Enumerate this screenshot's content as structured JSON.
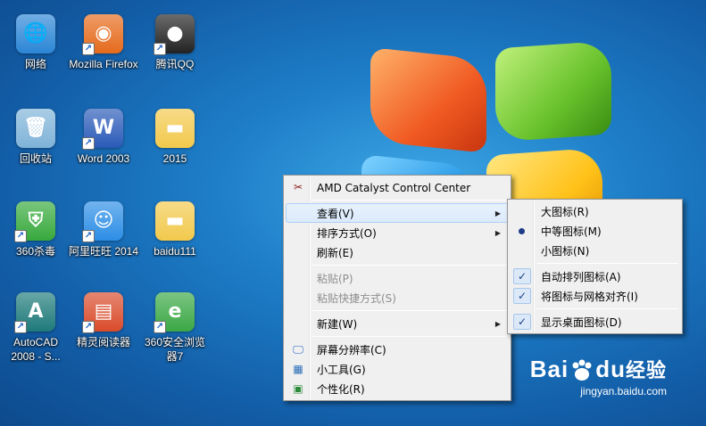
{
  "desktop": {
    "icons": [
      {
        "label": "网络",
        "color": "#2b86d6",
        "glyph": "network-icon",
        "shortcut": false
      },
      {
        "label": "Mozilla Firefox",
        "color": "#e56a1c",
        "glyph": "firefox-icon",
        "shortcut": true
      },
      {
        "label": "腾讯QQ",
        "color": "#222222",
        "glyph": "qq-penguin-icon",
        "shortcut": true
      },
      {
        "label": "回收站",
        "color": "#7fb3d8",
        "glyph": "recycle-bin-icon",
        "shortcut": false
      },
      {
        "label": "Word 2003",
        "color": "#2a5ab8",
        "glyph": "word-icon",
        "shortcut": true
      },
      {
        "label": "2015",
        "color": "#f2c94c",
        "glyph": "folder-icon",
        "shortcut": false
      },
      {
        "label": "360杀毒",
        "color": "#37a93c",
        "glyph": "shield-icon",
        "shortcut": true
      },
      {
        "label": "阿里旺旺 2014",
        "color": "#2c8ee6",
        "glyph": "aliwangwang-icon",
        "shortcut": true
      },
      {
        "label": "baidu111",
        "color": "#f2c94c",
        "glyph": "folder-icon",
        "shortcut": false
      },
      {
        "label": "AutoCAD 2008 - S...",
        "color": "#1e7a7a",
        "glyph": "autocad-icon",
        "shortcut": true
      },
      {
        "label": "精灵阅读器",
        "color": "#d94b2b",
        "glyph": "reader-icon",
        "shortcut": true
      },
      {
        "label": "360安全浏览器7",
        "color": "#3aa845",
        "glyph": "browser-360-icon",
        "shortcut": true
      }
    ]
  },
  "context_menu": {
    "items": [
      {
        "type": "item",
        "label": "AMD Catalyst Control Center",
        "icon": "amd-icon"
      },
      {
        "type": "sep"
      },
      {
        "type": "item",
        "label": "查看(V)",
        "submenu": true,
        "highlighted": true
      },
      {
        "type": "item",
        "label": "排序方式(O)",
        "submenu": true
      },
      {
        "type": "item",
        "label": "刷新(E)"
      },
      {
        "type": "sep"
      },
      {
        "type": "item",
        "label": "粘贴(P)",
        "disabled": true
      },
      {
        "type": "item",
        "label": "粘贴快捷方式(S)",
        "disabled": true
      },
      {
        "type": "sep"
      },
      {
        "type": "item",
        "label": "新建(W)",
        "submenu": true
      },
      {
        "type": "sep"
      },
      {
        "type": "item",
        "label": "屏幕分辨率(C)",
        "icon": "monitor-icon"
      },
      {
        "type": "item",
        "label": "小工具(G)",
        "icon": "gadgets-icon"
      },
      {
        "type": "item",
        "label": "个性化(R)",
        "icon": "personalize-icon"
      }
    ]
  },
  "view_submenu": {
    "items": [
      {
        "type": "item",
        "label": "大图标(R)"
      },
      {
        "type": "item",
        "label": "中等图标(M)",
        "radio": true
      },
      {
        "type": "item",
        "label": "小图标(N)"
      },
      {
        "type": "sep"
      },
      {
        "type": "item",
        "label": "自动排列图标(A)",
        "checked": true
      },
      {
        "type": "item",
        "label": "将图标与网格对齐(I)",
        "checked": true
      },
      {
        "type": "sep"
      },
      {
        "type": "item",
        "label": "显示桌面图标(D)",
        "checked": true
      }
    ]
  },
  "watermark": {
    "brand_left": "Bai",
    "brand_right": "du",
    "brand_cn": "经验",
    "url": "jingyan.baidu.com"
  }
}
